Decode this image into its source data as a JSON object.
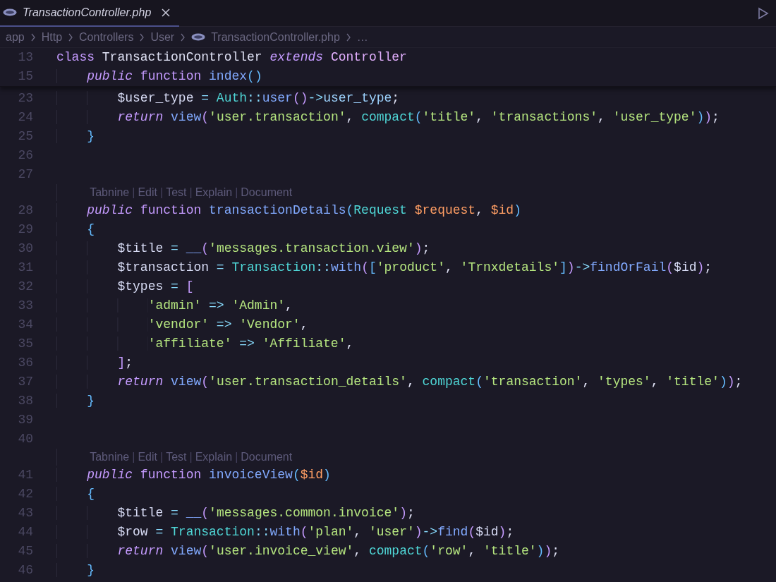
{
  "tab": {
    "title": "TransactionController.php",
    "preview": true,
    "selected": true
  },
  "breadcrumbs": [
    {
      "text": "app",
      "kind": "folder"
    },
    {
      "text": "Http",
      "kind": "folder"
    },
    {
      "text": "Controllers",
      "kind": "folder"
    },
    {
      "text": "User",
      "kind": "folder"
    },
    {
      "text": "TransactionController.php",
      "kind": "file"
    },
    {
      "text": "…",
      "kind": "more"
    }
  ],
  "sticky_lines": [
    {
      "number": "13",
      "tokens": [
        {
          "kind": "kw",
          "text": "class "
        },
        {
          "kind": "plain",
          "text": "TransactionController "
        },
        {
          "kind": "kwi",
          "text": "extends "
        },
        {
          "kind": "type",
          "text": "Controller"
        }
      ]
    },
    {
      "number": "15",
      "tokens": [
        {
          "kind": "kwi",
          "text": "    public "
        },
        {
          "kind": "kw",
          "text": "function "
        },
        {
          "kind": "fn",
          "text": "index"
        },
        {
          "kind": "br2",
          "text": "()"
        }
      ]
    }
  ],
  "lines": [
    {
      "kind": "code",
      "number": "23",
      "tokens": [
        {
          "kind": "var",
          "text": "        $user_type "
        },
        {
          "kind": "op",
          "text": "= "
        },
        {
          "kind": "cls",
          "text": "Auth"
        },
        {
          "kind": "op",
          "text": "::"
        },
        {
          "kind": "fn",
          "text": "user"
        },
        {
          "kind": "br1",
          "text": "()"
        },
        {
          "kind": "op",
          "text": "->"
        },
        {
          "kind": "prop",
          "text": "user_type"
        },
        {
          "kind": "plain",
          "text": ";"
        }
      ]
    },
    {
      "kind": "code",
      "number": "24",
      "tokens": [
        {
          "kind": "kwi",
          "text": "        return "
        },
        {
          "kind": "fn",
          "text": "view"
        },
        {
          "kind": "br1",
          "text": "("
        },
        {
          "kind": "str",
          "text": "'user.transaction'"
        },
        {
          "kind": "plain",
          "text": ", "
        },
        {
          "kind": "cls",
          "text": "compact"
        },
        {
          "kind": "br2",
          "text": "("
        },
        {
          "kind": "str",
          "text": "'title'"
        },
        {
          "kind": "plain",
          "text": ", "
        },
        {
          "kind": "str",
          "text": "'transactions'"
        },
        {
          "kind": "plain",
          "text": ", "
        },
        {
          "kind": "str",
          "text": "'user_type'"
        },
        {
          "kind": "br2",
          "text": ")"
        },
        {
          "kind": "br1",
          "text": ")"
        },
        {
          "kind": "plain",
          "text": ";"
        }
      ]
    },
    {
      "kind": "code",
      "number": "25",
      "tokens": [
        {
          "kind": "br2",
          "text": "    }"
        }
      ]
    },
    {
      "kind": "code",
      "number": "26"
    },
    {
      "kind": "code",
      "number": "27"
    },
    {
      "kind": "codelens",
      "parts": [
        {
          "kind": "link",
          "text": "Tabnine"
        },
        {
          "kind": "sep",
          "text": "|"
        },
        {
          "kind": "link",
          "text": "Edit"
        },
        {
          "kind": "sep",
          "text": "|"
        },
        {
          "kind": "link",
          "text": "Test"
        },
        {
          "kind": "sep",
          "text": "|"
        },
        {
          "kind": "link",
          "text": "Explain"
        },
        {
          "kind": "sep",
          "text": "|"
        },
        {
          "kind": "link",
          "text": "Document"
        }
      ]
    },
    {
      "kind": "code",
      "number": "28",
      "tokens": [
        {
          "kind": "kwi",
          "text": "    public "
        },
        {
          "kind": "kw",
          "text": "function "
        },
        {
          "kind": "fn",
          "text": "transactionDetails"
        },
        {
          "kind": "br2",
          "text": "("
        },
        {
          "kind": "cls",
          "text": "Request "
        },
        {
          "kind": "param",
          "text": "$request"
        },
        {
          "kind": "plain",
          "text": ", "
        },
        {
          "kind": "param",
          "text": "$id"
        },
        {
          "kind": "br2",
          "text": ")"
        }
      ]
    },
    {
      "kind": "code",
      "number": "29",
      "tokens": [
        {
          "kind": "br2",
          "text": "    {"
        }
      ]
    },
    {
      "kind": "code",
      "number": "30",
      "tokens": [
        {
          "kind": "var",
          "text": "        $title "
        },
        {
          "kind": "op",
          "text": "= "
        },
        {
          "kind": "fn",
          "text": "__"
        },
        {
          "kind": "br1",
          "text": "("
        },
        {
          "kind": "str",
          "text": "'messages.transaction.view'"
        },
        {
          "kind": "br1",
          "text": ")"
        },
        {
          "kind": "plain",
          "text": ";"
        }
      ]
    },
    {
      "kind": "code",
      "number": "31",
      "tokens": [
        {
          "kind": "var",
          "text": "        $transaction "
        },
        {
          "kind": "op",
          "text": "= "
        },
        {
          "kind": "cls",
          "text": "Transaction"
        },
        {
          "kind": "op",
          "text": "::"
        },
        {
          "kind": "fn",
          "text": "with"
        },
        {
          "kind": "br1",
          "text": "("
        },
        {
          "kind": "br2",
          "text": "["
        },
        {
          "kind": "str",
          "text": "'product'"
        },
        {
          "kind": "plain",
          "text": ", "
        },
        {
          "kind": "str",
          "text": "'Trnxdetails'"
        },
        {
          "kind": "br2",
          "text": "]"
        },
        {
          "kind": "br1",
          "text": ")"
        },
        {
          "kind": "op",
          "text": "->"
        },
        {
          "kind": "fn",
          "text": "findOrFail"
        },
        {
          "kind": "br1",
          "text": "("
        },
        {
          "kind": "var",
          "text": "$id"
        },
        {
          "kind": "br1",
          "text": ")"
        },
        {
          "kind": "plain",
          "text": ";"
        }
      ]
    },
    {
      "kind": "code",
      "number": "32",
      "tokens": [
        {
          "kind": "var",
          "text": "        $types "
        },
        {
          "kind": "op",
          "text": "= "
        },
        {
          "kind": "br1",
          "text": "["
        }
      ]
    },
    {
      "kind": "code",
      "number": "33",
      "tokens": [
        {
          "kind": "str",
          "text": "            'admin' "
        },
        {
          "kind": "op",
          "text": "=> "
        },
        {
          "kind": "str",
          "text": "'Admin'"
        },
        {
          "kind": "plain",
          "text": ","
        }
      ]
    },
    {
      "kind": "code",
      "number": "34",
      "tokens": [
        {
          "kind": "str",
          "text": "            'vendor' "
        },
        {
          "kind": "op",
          "text": "=> "
        },
        {
          "kind": "str",
          "text": "'Vendor'"
        },
        {
          "kind": "plain",
          "text": ","
        }
      ]
    },
    {
      "kind": "code",
      "number": "35",
      "tokens": [
        {
          "kind": "str",
          "text": "            'affiliate' "
        },
        {
          "kind": "op",
          "text": "=> "
        },
        {
          "kind": "str",
          "text": "'Affiliate'"
        },
        {
          "kind": "plain",
          "text": ","
        }
      ]
    },
    {
      "kind": "code",
      "number": "36",
      "tokens": [
        {
          "kind": "br1",
          "text": "        ]"
        },
        {
          "kind": "plain",
          "text": ";"
        }
      ]
    },
    {
      "kind": "code",
      "number": "37",
      "tokens": [
        {
          "kind": "kwi",
          "text": "        return "
        },
        {
          "kind": "fn",
          "text": "view"
        },
        {
          "kind": "br1",
          "text": "("
        },
        {
          "kind": "str",
          "text": "'user.transaction_details'"
        },
        {
          "kind": "plain",
          "text": ", "
        },
        {
          "kind": "cls",
          "text": "compact"
        },
        {
          "kind": "br2",
          "text": "("
        },
        {
          "kind": "str",
          "text": "'transaction'"
        },
        {
          "kind": "plain",
          "text": ", "
        },
        {
          "kind": "str",
          "text": "'types'"
        },
        {
          "kind": "plain",
          "text": ", "
        },
        {
          "kind": "str",
          "text": "'title'"
        },
        {
          "kind": "br2",
          "text": ")"
        },
        {
          "kind": "br1",
          "text": ")"
        },
        {
          "kind": "plain",
          "text": ";"
        }
      ]
    },
    {
      "kind": "code",
      "number": "38",
      "tokens": [
        {
          "kind": "br2",
          "text": "    }"
        }
      ]
    },
    {
      "kind": "code",
      "number": "39"
    },
    {
      "kind": "code",
      "number": "40"
    },
    {
      "kind": "codelens",
      "parts": [
        {
          "kind": "link",
          "text": "Tabnine"
        },
        {
          "kind": "sep",
          "text": "|"
        },
        {
          "kind": "link",
          "text": "Edit"
        },
        {
          "kind": "sep",
          "text": "|"
        },
        {
          "kind": "link",
          "text": "Test"
        },
        {
          "kind": "sep",
          "text": "|"
        },
        {
          "kind": "link",
          "text": "Explain"
        },
        {
          "kind": "sep",
          "text": "|"
        },
        {
          "kind": "link",
          "text": "Document"
        }
      ]
    },
    {
      "kind": "code",
      "number": "41",
      "tokens": [
        {
          "kind": "kwi",
          "text": "    public "
        },
        {
          "kind": "kw",
          "text": "function "
        },
        {
          "kind": "fn",
          "text": "invoiceView"
        },
        {
          "kind": "br2",
          "text": "("
        },
        {
          "kind": "param",
          "text": "$id"
        },
        {
          "kind": "br2",
          "text": ")"
        }
      ]
    },
    {
      "kind": "code",
      "number": "42",
      "tokens": [
        {
          "kind": "br2",
          "text": "    {"
        }
      ]
    },
    {
      "kind": "code",
      "number": "43",
      "tokens": [
        {
          "kind": "var",
          "text": "        $title "
        },
        {
          "kind": "op",
          "text": "= "
        },
        {
          "kind": "fn",
          "text": "__"
        },
        {
          "kind": "br1",
          "text": "("
        },
        {
          "kind": "str",
          "text": "'messages.common.invoice'"
        },
        {
          "kind": "br1",
          "text": ")"
        },
        {
          "kind": "plain",
          "text": ";"
        }
      ]
    },
    {
      "kind": "code",
      "number": "44",
      "tokens": [
        {
          "kind": "var",
          "text": "        $row "
        },
        {
          "kind": "op",
          "text": "= "
        },
        {
          "kind": "cls",
          "text": "Transaction"
        },
        {
          "kind": "op",
          "text": "::"
        },
        {
          "kind": "fn",
          "text": "with"
        },
        {
          "kind": "br1",
          "text": "("
        },
        {
          "kind": "str",
          "text": "'plan'"
        },
        {
          "kind": "plain",
          "text": ", "
        },
        {
          "kind": "str",
          "text": "'user'"
        },
        {
          "kind": "br1",
          "text": ")"
        },
        {
          "kind": "op",
          "text": "->"
        },
        {
          "kind": "fn",
          "text": "find"
        },
        {
          "kind": "br1",
          "text": "("
        },
        {
          "kind": "var",
          "text": "$id"
        },
        {
          "kind": "br1",
          "text": ")"
        },
        {
          "kind": "plain",
          "text": ";"
        }
      ]
    },
    {
      "kind": "code",
      "number": "45",
      "tokens": [
        {
          "kind": "kwi",
          "text": "        return "
        },
        {
          "kind": "fn",
          "text": "view"
        },
        {
          "kind": "br1",
          "text": "("
        },
        {
          "kind": "str",
          "text": "'user.invoice_view'"
        },
        {
          "kind": "plain",
          "text": ", "
        },
        {
          "kind": "cls",
          "text": "compact"
        },
        {
          "kind": "br2",
          "text": "("
        },
        {
          "kind": "str",
          "text": "'row'"
        },
        {
          "kind": "plain",
          "text": ", "
        },
        {
          "kind": "str",
          "text": "'title'"
        },
        {
          "kind": "br2",
          "text": ")"
        },
        {
          "kind": "br1",
          "text": ")"
        },
        {
          "kind": "plain",
          "text": ";"
        }
      ]
    },
    {
      "kind": "code",
      "number": "46",
      "tokens": [
        {
          "kind": "br2",
          "text": "    }"
        }
      ]
    }
  ]
}
